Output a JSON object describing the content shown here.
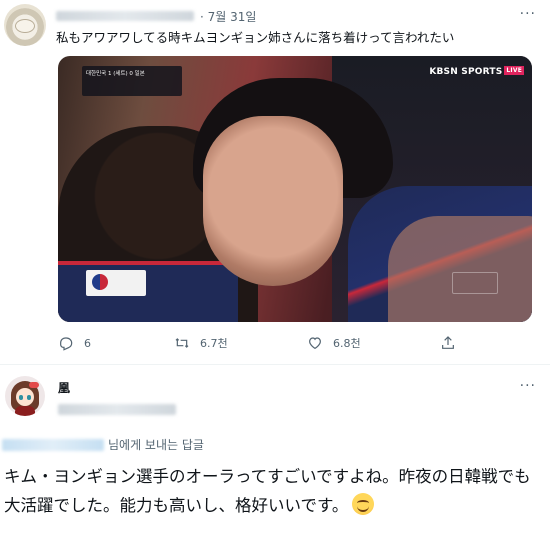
{
  "tweet": {
    "date": "· 7월 31일",
    "text": "私もアワアワしてる時キムヨンギョン姉さんに落ち着けって言われたい",
    "more_label": "···",
    "media": {
      "broadcaster": "KBSN SPORTS",
      "live_badge": "LIVE",
      "scoreboard": "대한민국 1 (세트) 0 일본"
    },
    "actions": {
      "reply_count": "6",
      "retweet_count": "6.7천",
      "like_count": "6.8천"
    }
  },
  "reply": {
    "author_name": "凰",
    "more_label": "···",
    "reply_to_suffix": "님에게 보내는 답글",
    "text": "キム・ヨンギョン選手のオーラってすごいですよね。昨夜の日韓戦でも大活躍でした。能力も高いし、格好いいです。"
  },
  "colors": {
    "text_primary": "#0f1419",
    "text_secondary": "#536471",
    "jersey_navy": "#1f2a57",
    "jersey_red": "#c8283a",
    "live_red": "#e0245e"
  },
  "icons": {
    "reply": "reply-icon",
    "retweet": "retweet-icon",
    "like": "heart-icon",
    "share": "share-icon",
    "more": "more-dots-icon"
  }
}
